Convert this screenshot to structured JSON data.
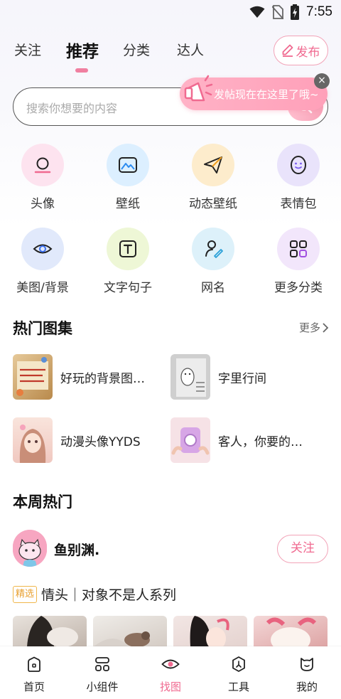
{
  "status_bar": {
    "time": "7:55"
  },
  "top_nav": {
    "tabs": [
      {
        "label": "关注"
      },
      {
        "label": "推荐"
      },
      {
        "label": "分类"
      },
      {
        "label": "达人"
      }
    ],
    "active_tab": "推荐",
    "publish_label": "发布"
  },
  "search": {
    "placeholder": "搜索你想要的内容",
    "tip": "发帖现在在这里了哦~",
    "tip_close": "×"
  },
  "categories": [
    {
      "label": "头像",
      "icon": "avatar-icon",
      "bg": "#fde3ef"
    },
    {
      "label": "壁纸",
      "icon": "wallpaper-icon",
      "bg": "#dcefff"
    },
    {
      "label": "动态壁纸",
      "icon": "paper-plane-icon",
      "bg": "#fdeccc"
    },
    {
      "label": "表情包",
      "icon": "emoji-icon",
      "bg": "#e9e3fb"
    },
    {
      "label": "美图/背景",
      "icon": "eye-icon",
      "bg": "#e1e9fb"
    },
    {
      "label": "文字句子",
      "icon": "text-icon",
      "bg": "#eef7d6"
    },
    {
      "label": "网名",
      "icon": "nickname-icon",
      "bg": "#ddf1fa"
    },
    {
      "label": "更多分类",
      "icon": "grid-icon",
      "bg": "#f2e6fb"
    }
  ],
  "hot_albums": {
    "title": "热门图集",
    "more": "更多",
    "items": [
      {
        "title": "好玩的背景图万..."
      },
      {
        "title": "字里行间"
      },
      {
        "title": "动漫头像YYDS"
      },
      {
        "title": "客人，你要的背..."
      }
    ]
  },
  "weekly_hot": {
    "title": "本周热门",
    "user": {
      "name": "鱼别渊."
    },
    "follow_label": "关注",
    "badge": "精选",
    "post_title": "情头｜对象不是人系列"
  },
  "bottom_nav": {
    "items": [
      {
        "label": "首页"
      },
      {
        "label": "小组件"
      },
      {
        "label": "找图"
      },
      {
        "label": "工具"
      },
      {
        "label": "我的"
      }
    ],
    "active": "找图"
  },
  "colors": {
    "accent": "#f06a90",
    "accent_light": "#ffb2c6"
  }
}
